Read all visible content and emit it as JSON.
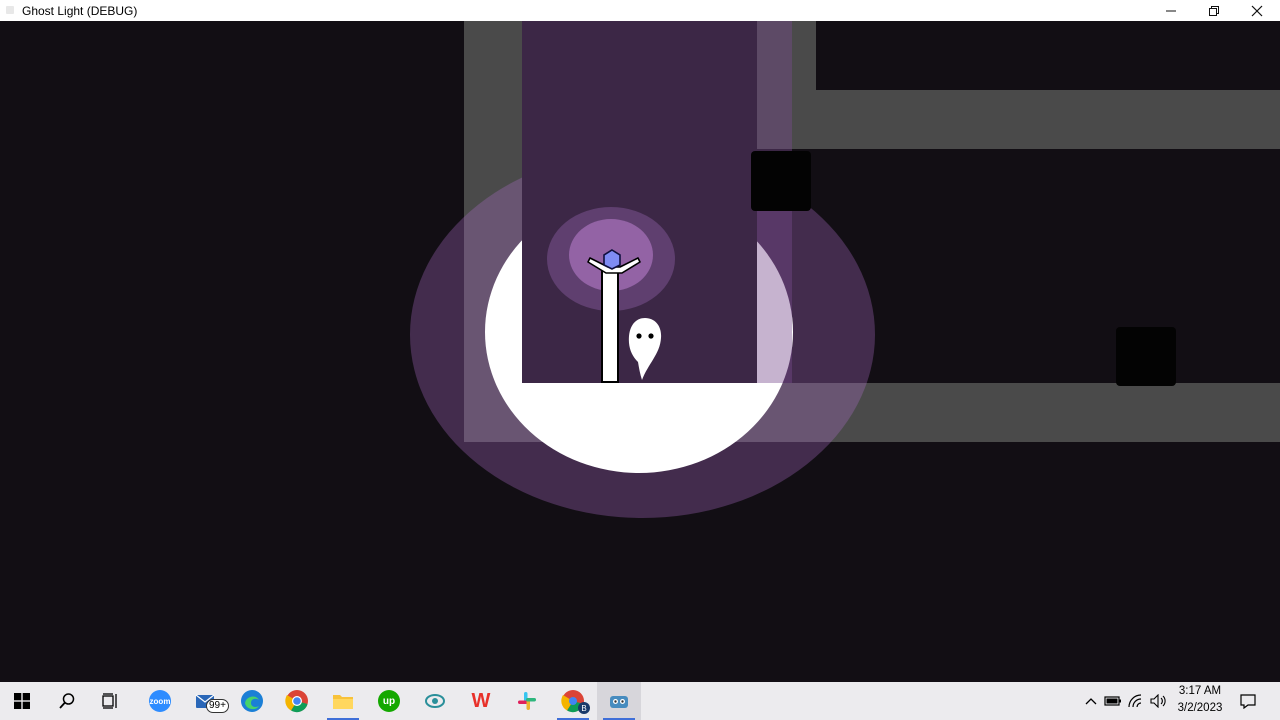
{
  "window": {
    "title": "Ghost Light (DEBUG)"
  },
  "taskbar": {
    "mail_badge": "99+",
    "chrome_profile_badge": "B",
    "zoom_label": "zoom",
    "upwork_label": "up",
    "wps_label": "W",
    "clock_time": "3:17 AM",
    "clock_date": "3/2/2023"
  },
  "colors": {
    "background": "#120e14",
    "wall": "#4a4a4a",
    "light": "#ffffff",
    "crystal": "#7f8cf4",
    "taskbar": "#ecebee"
  }
}
